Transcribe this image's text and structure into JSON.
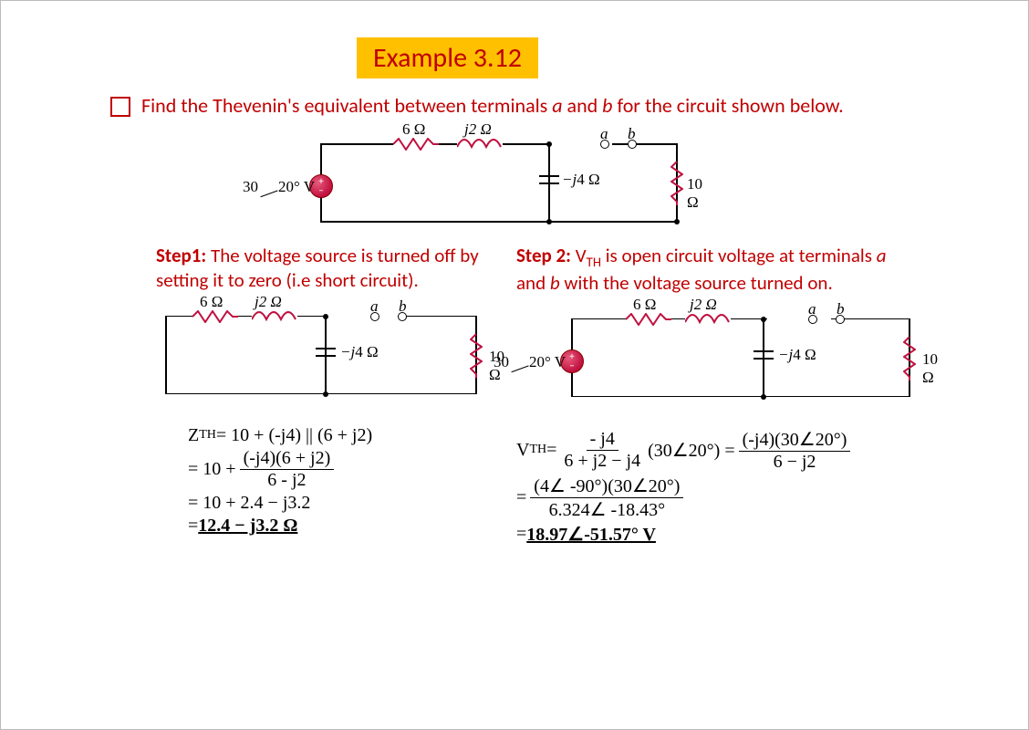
{
  "title": "Example 3.12",
  "prompt_pre": "Find the Thevenin's equivalent between terminals ",
  "prompt_a": "a",
  "prompt_mid": " and ",
  "prompt_b": "b",
  "prompt_post": " for  the circuit  shown below.",
  "step1": {
    "label": "Step1:",
    "text": " The voltage source is turned off by setting it to zero (i.e short circuit)."
  },
  "step2": {
    "label": "Step 2:",
    "pre": " V",
    "sub": "TH",
    "mid": " is open circuit voltage at terminals ",
    "a": "a",
    "and": " and ",
    "b": "b",
    "post": " with the voltage source turned on."
  },
  "circuit": {
    "src": "30∠ 20° V",
    "r6": "6 Ω",
    "j2": "j2 Ω",
    "mj4": "−j4 Ω",
    "r10": "10 Ω",
    "a": "a",
    "b": "b"
  },
  "math_left": {
    "l1_pre": "Z",
    "l1_sub": "TH",
    "l1_rhs": "= 10 + (-j4) || (6 + j2)",
    "l2_pre": "= 10 +",
    "l2_num": "(-j4)(6 + j2)",
    "l2_den": "6 - j2",
    "l3": "= 10 + 2.4 − j3.2",
    "l4_pre": "= ",
    "l4_u": "12.4 − j3.2 Ω"
  },
  "math_right": {
    "l1_pre": "V",
    "l1_sub": "TH",
    "l1_eq": "=",
    "l1_num": "- j4",
    "l1_den": "6 + j2 − j4",
    "l1_mid": "(30∠20°) =",
    "l1b_num": "(-j4)(30∠20°)",
    "l1b_den": "6 − j2",
    "l2_eq": "=",
    "l2_num": "(4∠ -90°)(30∠20°)",
    "l2_den": "6.324∠ -18.43°",
    "l3_pre": "= ",
    "l3_u": "18.97∠-51.57° V"
  }
}
